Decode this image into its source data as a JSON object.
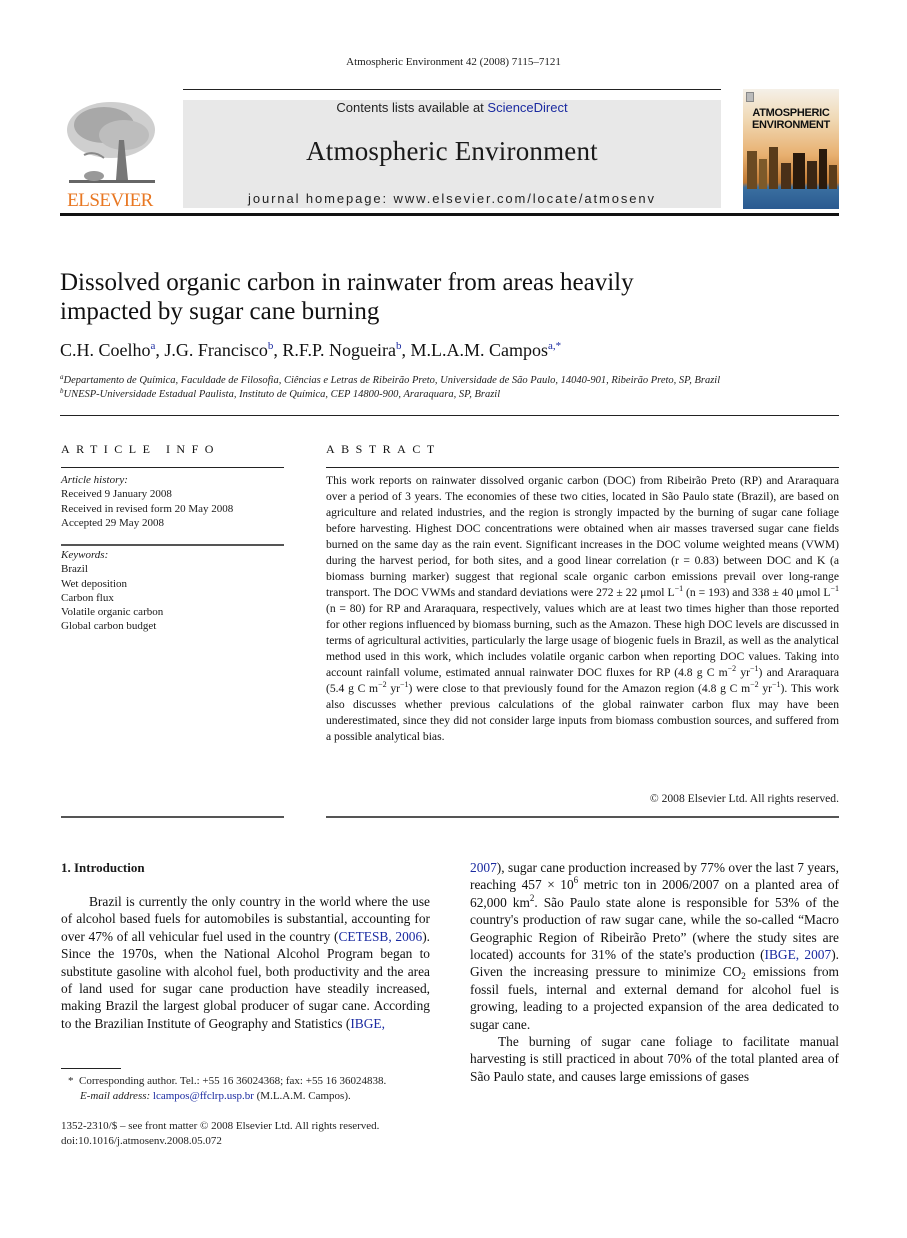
{
  "running_head": "Atmospheric Environment 42 (2008) 7115–7121",
  "banner": {
    "contents_prefix": "Contents lists available at ",
    "contents_link": "ScienceDirect",
    "journal_title": "Atmospheric Environment",
    "homepage": "journal homepage: www.elsevier.com/locate/atmosenv"
  },
  "publisher_logo": {
    "text": "ELSEVIER",
    "color": "#e87722",
    "icon": "tree-logo-icon"
  },
  "cover": {
    "title_line1": "ATMOSPHERIC",
    "title_line2": "ENVIRONMENT"
  },
  "article": {
    "title_line1": "Dissolved organic carbon in rainwater from areas heavily",
    "title_line2": "impacted by sugar cane burning",
    "authors": [
      {
        "name": "C.H. Coelho",
        "affil": "a",
        "sep": ", "
      },
      {
        "name": "J.G. Francisco",
        "affil": "b",
        "sep": ", "
      },
      {
        "name": "R.F.P. Nogueira",
        "affil": "b",
        "sep": ", "
      },
      {
        "name": "M.L.A.M. Campos",
        "affil": "a,*",
        "sep": ""
      }
    ],
    "affiliations": [
      {
        "key": "a",
        "text": "Departamento de Química, Faculdade de Filosofia, Ciências e Letras de Ribeirão Preto, Universidade de São Paulo, 14040-901, Ribeirão Preto, SP, Brazil"
      },
      {
        "key": "b",
        "text": "UNESP-Universidade Estadual Paulista, Instituto de Química, CEP 14800-900, Araraquara, SP, Brazil"
      }
    ]
  },
  "article_info": {
    "heading": "ARTICLE INFO",
    "history_label": "Article history:",
    "history": [
      "Received 9 January 2008",
      "Received in revised form 20 May 2008",
      "Accepted 29 May 2008"
    ],
    "keywords_label": "Keywords:",
    "keywords": [
      "Brazil",
      "Wet deposition",
      "Carbon flux",
      "Volatile organic carbon",
      "Global carbon budget"
    ]
  },
  "abstract": {
    "heading": "ABSTRACT",
    "p1": "This work reports on rainwater dissolved organic carbon (DOC) from Ribeirão Preto (RP) and Araraquara over a period of 3 years. The economies of these two cities, located in São Paulo state (Brazil), are based on agriculture and related industries, and the region is strongly impacted by the burning of sugar cane foliage before harvesting. Highest DOC concentrations were obtained when air masses traversed sugar cane fields burned on the same day as the rain event. Significant increases in the DOC volume weighted means (VWM) during the harvest period, for both sites, and a good linear correlation (r = 0.83) between DOC and K (a biomass burning marker) suggest that regional scale organic carbon emissions prevail over long-range transport. The DOC VWMs and standard deviations were 272 ± 22 μmol L",
    "p2": " (n = 193) and 338 ± 40 μmol L",
    "p3": " (n = 80) for RP and Araraquara, respectively, values which are at least two times higher than those reported for other regions influenced by biomass burning, such as the Amazon. These high DOC levels are discussed in terms of agricultural activities, particularly the large usage of biogenic fuels in Brazil, as well as the analytical method used in this work, which includes volatile organic carbon when reporting DOC values. Taking into account rainfall volume, estimated annual rainwater DOC fluxes for RP (4.8 g C m",
    "p4": " yr",
    "p5": ") and Araraquara (5.4 g C m",
    "p6": ") were close to that previously found for the Amazon region (4.8 g C m",
    "p7": "). This work also discusses whether previous calculations of the global rainwater carbon flux may have been underestimated, since they did not consider large inputs from biomass combustion sources, and suffered from a possible analytical bias.",
    "exp_m1": "−1",
    "exp_m2": "−2",
    "copyright": "© 2008 Elsevier Ltd. All rights reserved."
  },
  "intro": {
    "heading": "1.  Introduction",
    "left_a": "Brazil is currently the only country in the world where the use of alcohol based fuels for automobiles is substantial, accounting for over 47% of all vehicular fuel used in the country (",
    "cite_cetesb": "CETESB, 2006",
    "left_b": "). Since the 1970s, when the National Alcohol Program began to substitute gasoline with alcohol fuel, both productivity and the area of land used for sugar cane production have steadily increased, making Brazil the largest global producer of sugar cane. According to the Brazilian Institute of Geography and Statistics (",
    "cite_ibge_1a": "IBGE,",
    "cite_ibge_1b": "2007",
    "right_a": "), sugar cane production increased by 77% over the last 7 years, reaching 457 × 10",
    "exp_6": "6",
    "right_b": " metric ton in 2006/2007 on a planted area of 62,000 km",
    "exp_2": "2",
    "right_c": ". São Paulo state alone is responsible for 53% of the country's production of raw sugar cane, while the so-called “Macro Geographic Region of Ribeirão Preto” (where the study sites are located) accounts for 31% of the state's production (",
    "cite_ibge_2": "IBGE, 2007",
    "right_d": "). Given the increasing pressure to minimize CO",
    "sub_2": "2",
    "right_e": " emissions from fossil fuels, internal and external demand for alcohol fuel is growing, leading to a projected expansion of the area dedicated to sugar cane.",
    "right_p2": "The burning of sugar cane foliage to facilitate manual harvesting is still practiced in about 70% of the total planted area of São Paulo state, and causes large emissions of gases"
  },
  "footnotes": {
    "star": "*",
    "corresponding": "Corresponding author. Tel.: +55 16 36024368; fax: +55 16 36024838.",
    "email_label": "E-mail address:",
    "email": "lcampos@ffclrp.usp.br",
    "email_suffix": " (M.L.A.M. Campos).",
    "front_matter": "1352-2310/$ – see front matter © 2008 Elsevier Ltd. All rights reserved.",
    "doi": "doi:10.1016/j.atmosenv.2008.05.072"
  }
}
